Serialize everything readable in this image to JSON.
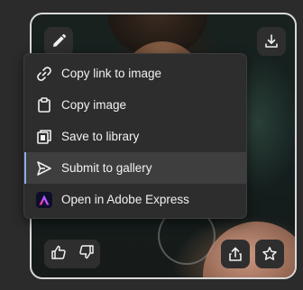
{
  "menu": {
    "items": [
      {
        "label": "Copy link to image",
        "icon": "link-icon"
      },
      {
        "label": "Copy image",
        "icon": "clipboard-icon"
      },
      {
        "label": "Save to library",
        "icon": "library-icon"
      },
      {
        "label": "Submit to gallery",
        "icon": "send-icon"
      },
      {
        "label": "Open in Adobe Express",
        "icon": "adobe-express-icon"
      }
    ]
  },
  "card": {
    "edit_icon": "pencil-icon",
    "download_icon": "download-icon",
    "like_icon": "thumbs-up-icon",
    "dislike_icon": "thumbs-down-icon",
    "share_icon": "share-icon",
    "favorite_icon": "star-icon"
  },
  "colors": {
    "menu_bg": "#2d2d2d",
    "menu_active_bg": "#3e3e3e",
    "active_indicator": "#8ea9e8",
    "card_border": "#d9d9d9"
  }
}
